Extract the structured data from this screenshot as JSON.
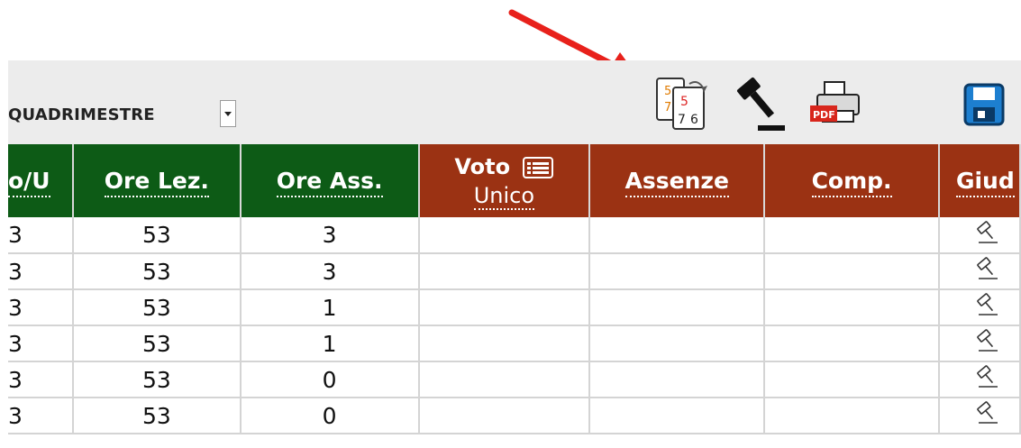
{
  "toolbar": {
    "period_label": "QUADRIMESTRE",
    "icons": [
      "copy-grades-icon",
      "gavel-icon",
      "print-pdf-icon",
      "save-icon"
    ],
    "pdf_label": "PDF",
    "copy_icon_digits": [
      "5",
      "7",
      "5",
      "7",
      "6"
    ]
  },
  "table": {
    "headers": {
      "first": "o/U",
      "ore_lez": "Ore Lez.",
      "ore_ass": "Ore Ass.",
      "voto_top": "Voto",
      "voto_bottom": "Unico",
      "assenze": "Assenze",
      "comp": "Comp.",
      "giud": "Giud"
    },
    "rows": [
      {
        "first": "3",
        "ore_lez": "53",
        "ore_ass": "3",
        "voto": "",
        "assenze": "",
        "comp": ""
      },
      {
        "first": "3",
        "ore_lez": "53",
        "ore_ass": "3",
        "voto": "",
        "assenze": "",
        "comp": ""
      },
      {
        "first": "3",
        "ore_lez": "53",
        "ore_ass": "1",
        "voto": "",
        "assenze": "",
        "comp": ""
      },
      {
        "first": "3",
        "ore_lez": "53",
        "ore_ass": "1",
        "voto": "",
        "assenze": "",
        "comp": ""
      },
      {
        "first": "3",
        "ore_lez": "53",
        "ore_ass": "0",
        "voto": "",
        "assenze": "",
        "comp": ""
      },
      {
        "first": "3",
        "ore_lez": "53",
        "ore_ass": "0",
        "voto": "",
        "assenze": "",
        "comp": ""
      }
    ]
  },
  "colors": {
    "green_header": "#0d5b16",
    "red_header": "#9b3213",
    "annotation_arrow": "#e8211b",
    "save_icon": "#1d7fd0"
  }
}
